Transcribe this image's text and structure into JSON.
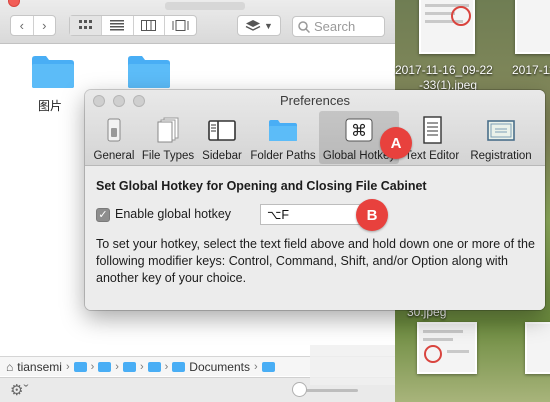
{
  "finder": {
    "search_placeholder": "Search",
    "folders": [
      {
        "label": "图片"
      },
      {
        "label": ""
      }
    ],
    "path": [
      "tiansemi",
      "",
      "",
      "",
      "",
      "Documents",
      ""
    ]
  },
  "desktop": {
    "thumbnails": [
      {
        "name": "2017-11-16_09-22"
      },
      {
        "name": "2017-11-"
      },
      {
        "name": "-33(1).jpeg"
      },
      {
        "name": "30.jpeg"
      }
    ]
  },
  "prefs": {
    "title": "Preferences",
    "tabs": [
      {
        "id": "general",
        "label": "General"
      },
      {
        "id": "file-types",
        "label": "File Types"
      },
      {
        "id": "sidebar",
        "label": "Sidebar"
      },
      {
        "id": "folder-paths",
        "label": "Folder Paths"
      },
      {
        "id": "global-hotkey",
        "label": "Global Hotkey",
        "selected": true
      },
      {
        "id": "text-editor",
        "label": "Text Editor"
      },
      {
        "id": "registration",
        "label": "Registration"
      }
    ],
    "section_title": "Set Global Hotkey for Opening and Closing File Cabinet",
    "checkbox_label": "Enable global hotkey",
    "checkbox_checked": true,
    "hotkey_value": "⌥F",
    "help_text": "To set your hotkey, select the text field above and hold down one or more of the following modifier keys: Control, Command, Shift, and/or Option along with another key of your choice."
  },
  "annotations": {
    "a": "A",
    "b": "B",
    "color": "#e8413d"
  },
  "colors": {
    "folder_blue": "#49aef5",
    "accent_red": "#e8413d"
  }
}
